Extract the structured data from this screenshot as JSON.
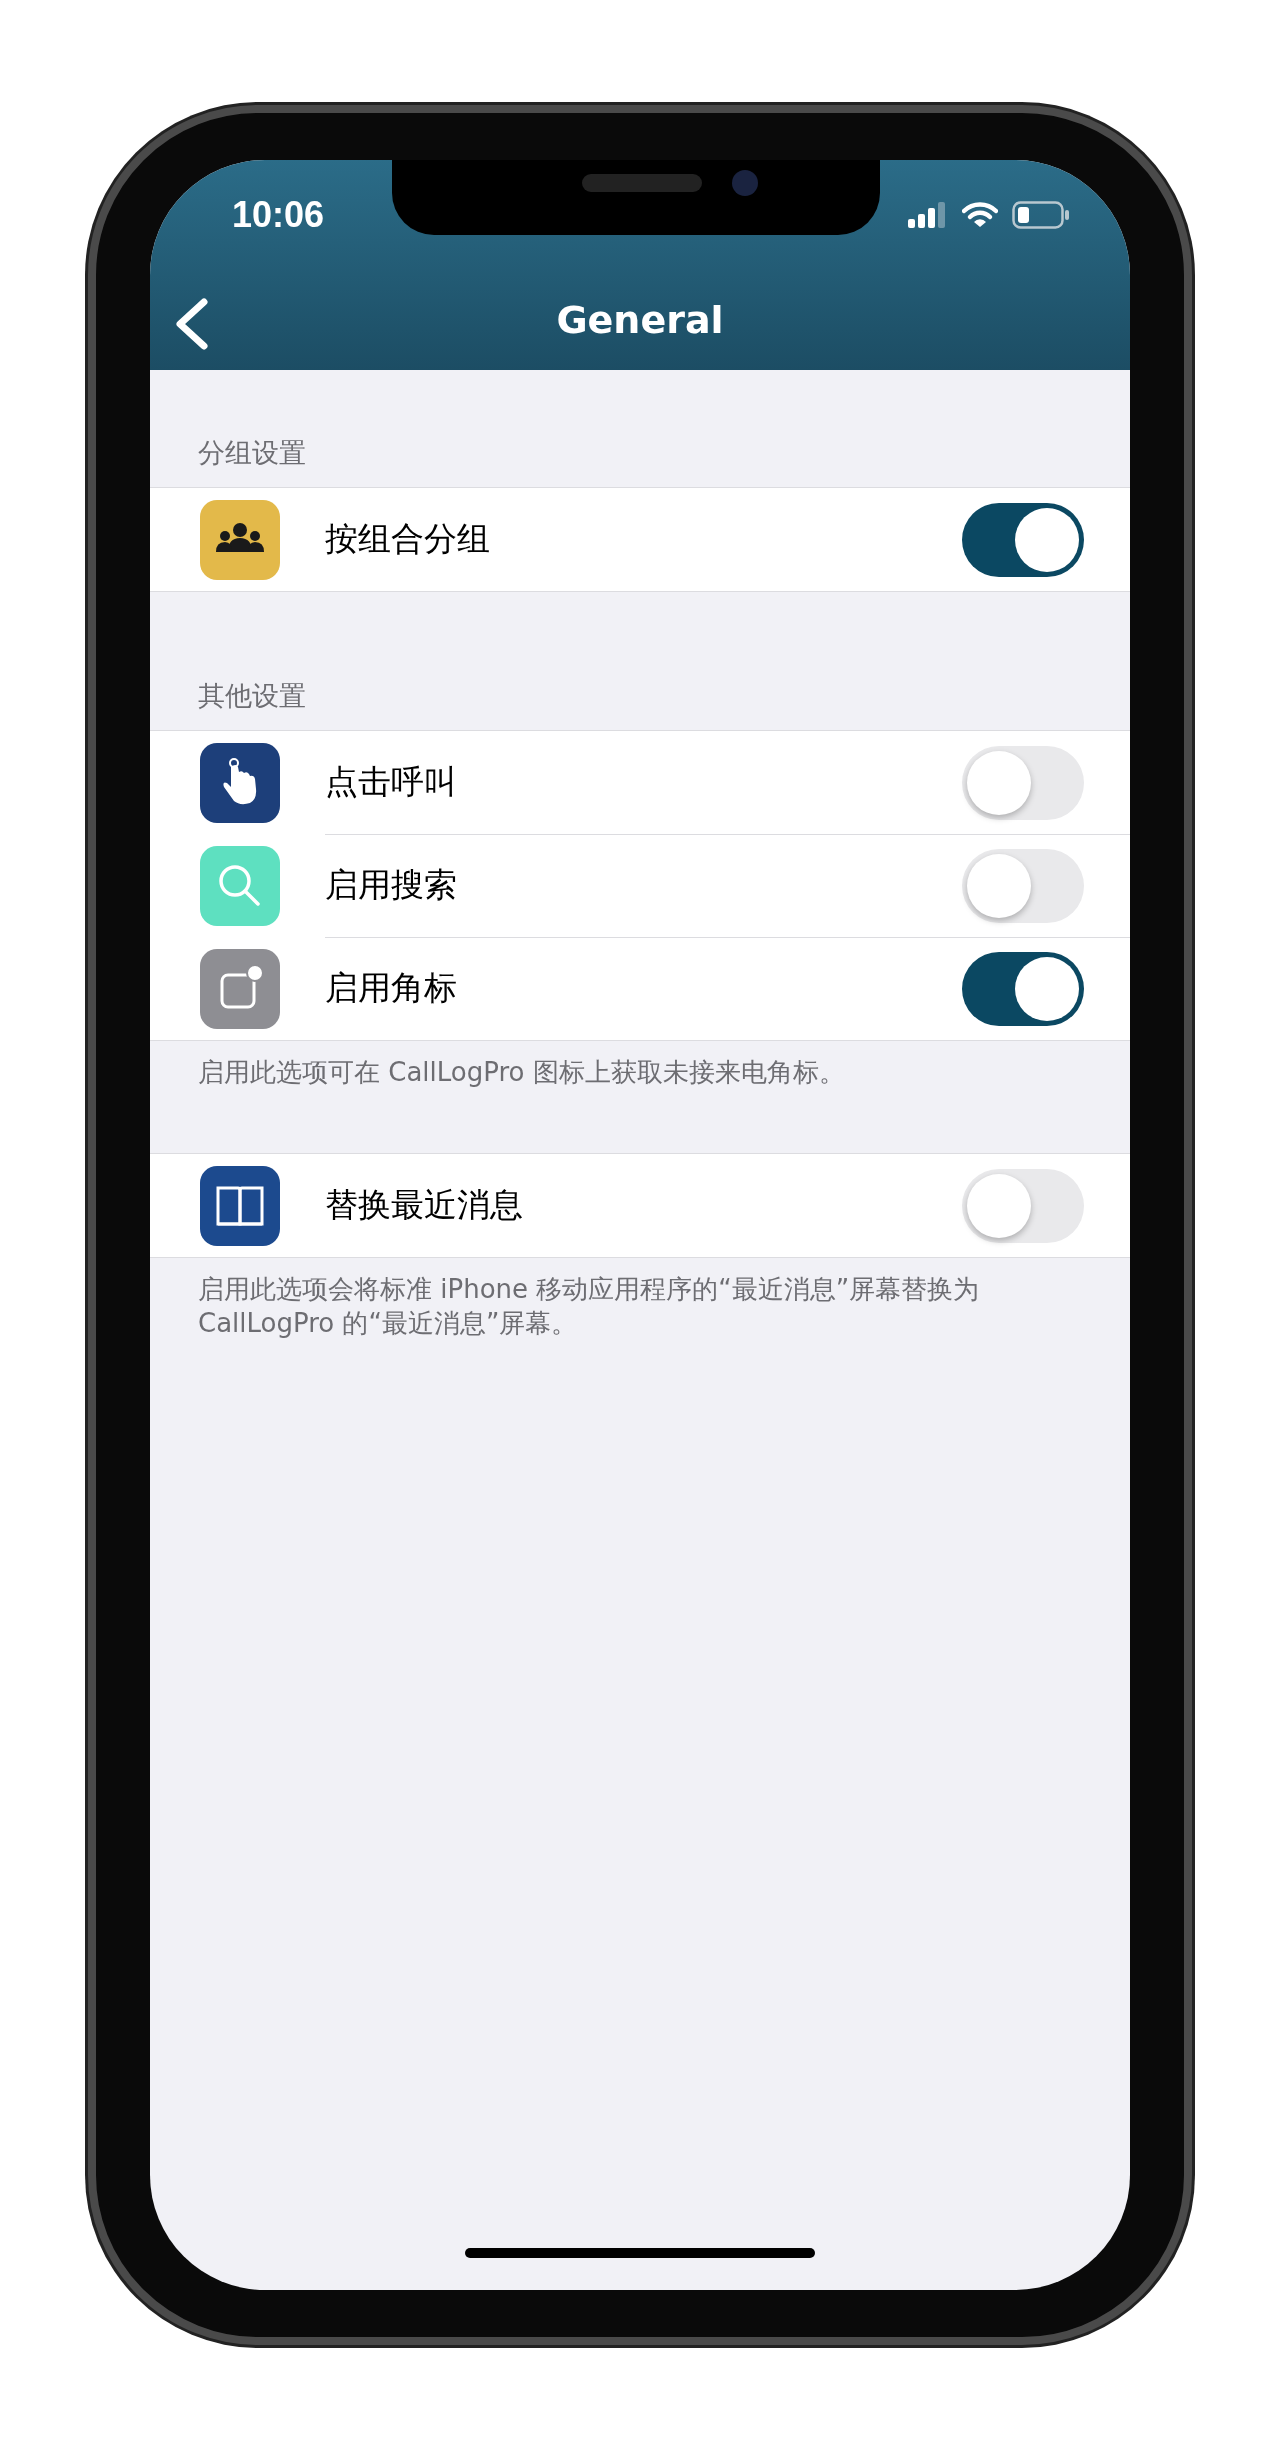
{
  "status_bar": {
    "time": "10:06"
  },
  "nav": {
    "title": "General"
  },
  "sections": [
    {
      "header": "分组设置",
      "rows": [
        {
          "label": "按组合分组",
          "on": true
        }
      ]
    },
    {
      "header": "其他设置",
      "rows": [
        {
          "label": "点击呼叫",
          "on": false
        },
        {
          "label": "启用搜索",
          "on": false
        },
        {
          "label": "启用角标",
          "on": true
        }
      ],
      "footer": "启用此选项可在 CallLogPro 图标上获取未接来电角标。"
    },
    {
      "rows": [
        {
          "label": "替换最近消息",
          "on": false
        }
      ],
      "footer": "启用此选项会将标准 iPhone 移动应用程序的“最近消息”屏幕替换为 CallLogPro 的“最近消息”屏幕。"
    }
  ]
}
